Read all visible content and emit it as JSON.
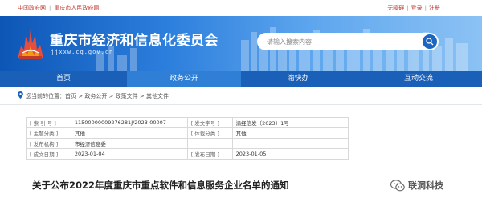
{
  "topbar": {
    "left_links": [
      "中国政府网",
      "重庆市人民政府网"
    ],
    "right_links": [
      "无障碍",
      "登录",
      "注册"
    ]
  },
  "header": {
    "site_title": "重庆市经济和信息化委员会",
    "site_url": "jjxxw.cq.gov.cn",
    "search_placeholder": "请输入搜索内容"
  },
  "nav": {
    "items": [
      {
        "label": "首页",
        "active": false
      },
      {
        "label": "政务公开",
        "active": true
      },
      {
        "label": "渝快办",
        "active": false
      },
      {
        "label": "互动交流",
        "active": false
      }
    ]
  },
  "breadcrumb": {
    "text": "您当前的位置：首页 > 政务公开 > 政策文件 > 其他文件"
  },
  "meta": {
    "rows": [
      {
        "k1": "[ 索 引 号 ]",
        "v1": "11500000009276281J/2023-00007",
        "k2": "[ 发文字号 ]",
        "v2": "渝经信发〔2023〕1号"
      },
      {
        "k1": "[ 主题分类 ]",
        "v1": "其他",
        "k2": "[ 体裁分类 ]",
        "v2": "其他"
      },
      {
        "k1": "[ 发布机构 ]",
        "v1": "市经济信息委",
        "k2": "",
        "v2": ""
      },
      {
        "k1": "[ 成文日期 ]",
        "v1": "2023-01-04",
        "k2": "[ 发布日期 ]",
        "v2": "2023-01-05"
      }
    ]
  },
  "document": {
    "title": "关于公布2022年度重庆市重点软件和信息服务企业名单的通知"
  },
  "watermark": {
    "text": "联洞科技"
  },
  "colors": {
    "nav_bg": "#1a5fb8",
    "nav_active": "#2f7fd6",
    "banner_start": "#0d56b6",
    "banner_end": "#8cc2f4",
    "accent_red": "#c0392b"
  }
}
